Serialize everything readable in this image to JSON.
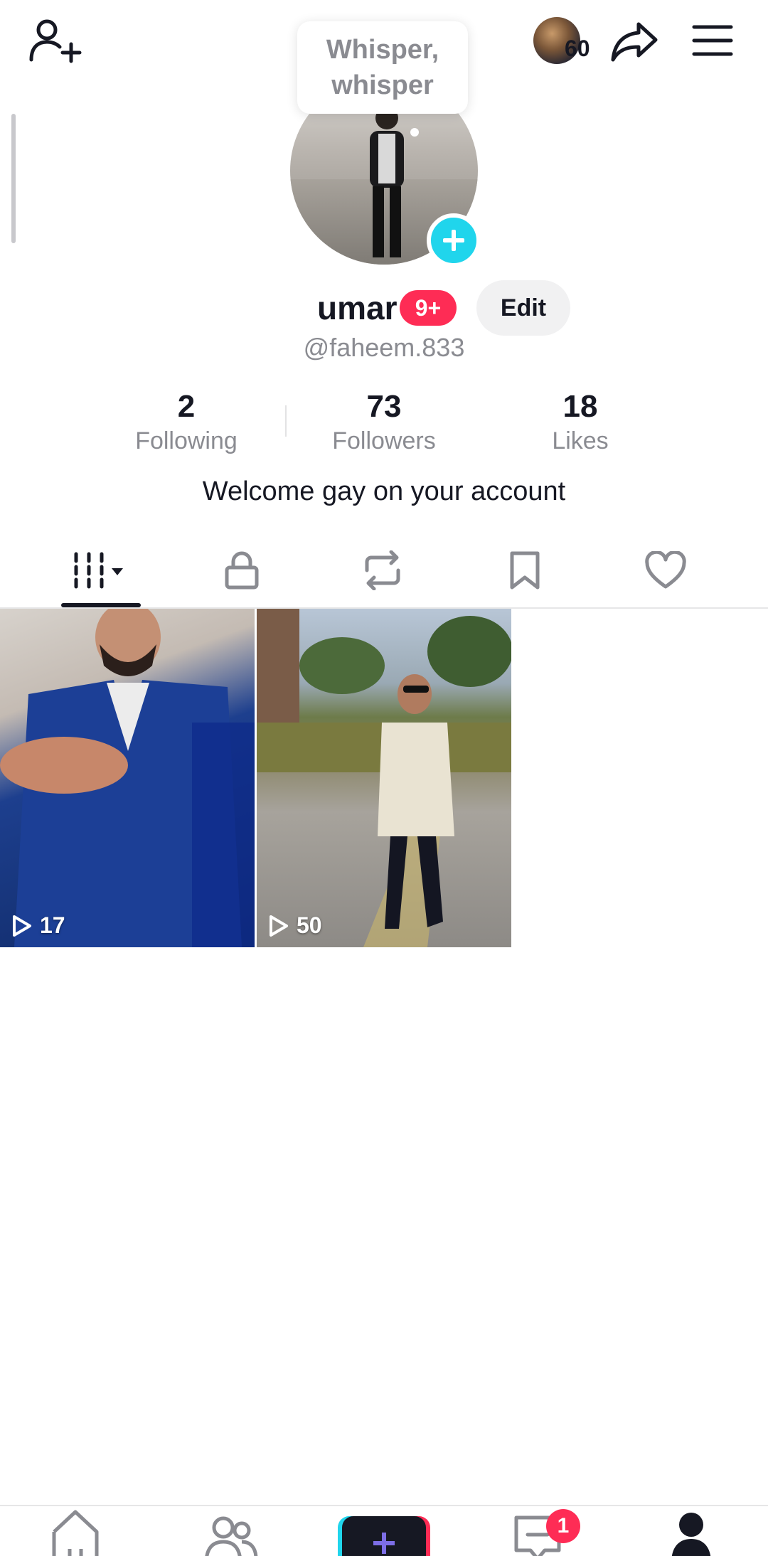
{
  "header": {
    "add_friend_icon": "person-add-icon",
    "coin_count": "60",
    "share_icon": "share-arrow-icon",
    "menu_icon": "hamburger-menu-icon"
  },
  "profile": {
    "tooltip": "Whisper, whisper",
    "username": "umar",
    "badge": "9+",
    "edit_label": "Edit",
    "handle": "@faheem.833",
    "bio": "Welcome gay on your account"
  },
  "stats": [
    {
      "value": "2",
      "label": "Following"
    },
    {
      "value": "73",
      "label": "Followers"
    },
    {
      "value": "18",
      "label": "Likes"
    }
  ],
  "tabs": [
    {
      "icon": "grid-videos-icon",
      "active": true
    },
    {
      "icon": "lock-icon",
      "active": false
    },
    {
      "icon": "repost-icon",
      "active": false
    },
    {
      "icon": "bookmark-icon",
      "active": false
    },
    {
      "icon": "heart-icon",
      "active": false
    }
  ],
  "videos": [
    {
      "views": "17"
    },
    {
      "views": "50"
    }
  ],
  "bottom_nav": {
    "inbox_badge": "1"
  },
  "colors": {
    "accent_red": "#fe2c55",
    "accent_cyan": "#20d5ec",
    "text_primary": "#161823",
    "text_secondary": "#8a8b91"
  }
}
